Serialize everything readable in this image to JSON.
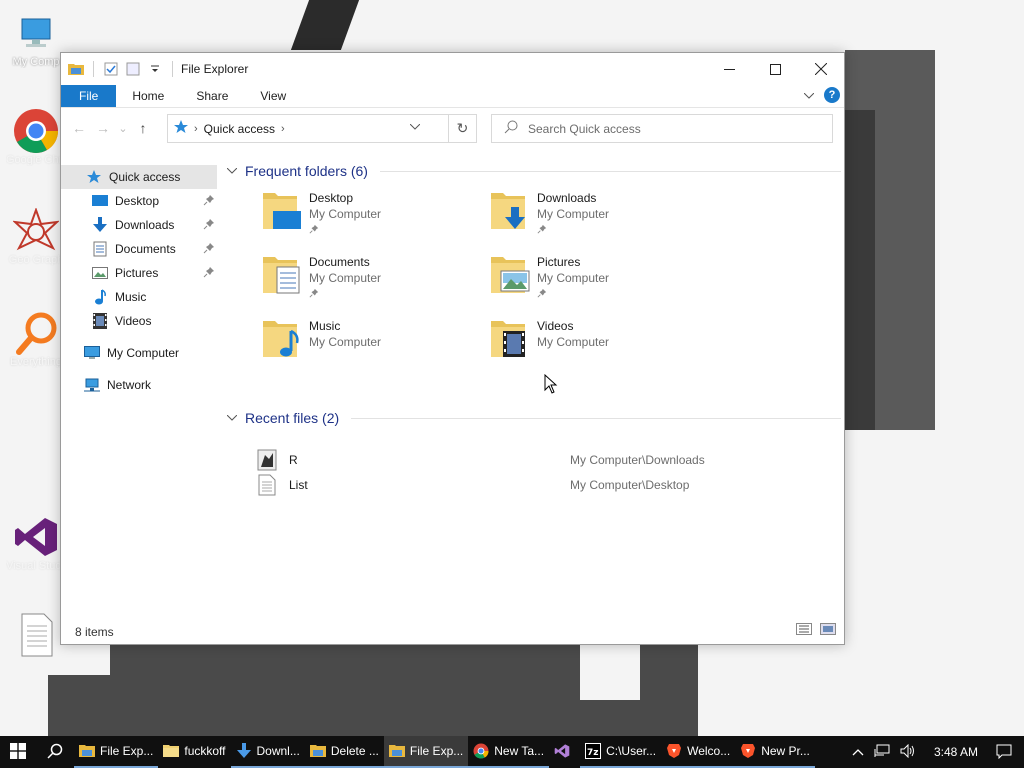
{
  "desktop": {
    "icons": [
      {
        "label": "My Comp",
        "icon": "computer-icon"
      },
      {
        "label": "Google Chrome",
        "icon": "chrome-icon"
      },
      {
        "label": "Geo Graph",
        "icon": "star-icon"
      },
      {
        "label": "Everything",
        "icon": "everything-icon"
      },
      {
        "label": "Visual Studio",
        "icon": "visual-studio-icon"
      },
      {
        "label": "",
        "icon": "document-icon"
      }
    ]
  },
  "window": {
    "title": "File Explorer",
    "controls": {
      "minimize": "—",
      "maximize": "☐",
      "close": "✕"
    }
  },
  "ribbon": {
    "tabs": [
      "File",
      "Home",
      "Share",
      "View"
    ],
    "help": "?"
  },
  "navbar": {
    "back": "←",
    "forward": "→",
    "recent": "⌄",
    "up": "↑",
    "address": "Quick access",
    "refresh": "↻",
    "search_placeholder": "Search Quick access"
  },
  "sidebar": {
    "items": [
      {
        "label": "Quick access",
        "icon": "star-icon",
        "selected": true
      },
      {
        "label": "Desktop",
        "icon": "desktop-icon",
        "pinned": true
      },
      {
        "label": "Downloads",
        "icon": "download-icon",
        "pinned": true
      },
      {
        "label": "Documents",
        "icon": "documents-icon",
        "pinned": true
      },
      {
        "label": "Pictures",
        "icon": "pictures-icon",
        "pinned": true
      },
      {
        "label": "Music",
        "icon": "music-icon"
      },
      {
        "label": "Videos",
        "icon": "videos-icon"
      },
      {
        "label": "My Computer",
        "icon": "computer-icon"
      },
      {
        "label": "Network",
        "icon": "network-icon"
      }
    ]
  },
  "frequent": {
    "header": "Frequent folders (6)",
    "folders": [
      {
        "name": "Desktop",
        "location": "My Computer",
        "pinned": true
      },
      {
        "name": "Downloads",
        "location": "My Computer",
        "pinned": true
      },
      {
        "name": "Documents",
        "location": "My Computer",
        "pinned": true
      },
      {
        "name": "Pictures",
        "location": "My Computer",
        "pinned": true
      },
      {
        "name": "Music",
        "location": "My Computer",
        "pinned": false
      },
      {
        "name": "Videos",
        "location": "My Computer",
        "pinned": false
      }
    ]
  },
  "recent": {
    "header": "Recent files (2)",
    "files": [
      {
        "name": "R",
        "path": "My Computer\\Downloads"
      },
      {
        "name": "List",
        "path": "My Computer\\Desktop"
      }
    ]
  },
  "status": {
    "items": "8 items"
  },
  "taskbar": {
    "items": [
      {
        "label": "File Exp...",
        "icon": "folder-icon",
        "state": "open"
      },
      {
        "label": "fuckkoff",
        "icon": "folder-icon",
        "state": "none"
      },
      {
        "label": "Downl...",
        "icon": "download-icon",
        "state": "open"
      },
      {
        "label": "Delete ...",
        "icon": "folder-icon",
        "state": "open"
      },
      {
        "label": "File Exp...",
        "icon": "folder-icon",
        "state": "active"
      },
      {
        "label": "New Ta...",
        "icon": "chrome-icon",
        "state": "open"
      },
      {
        "label": "",
        "icon": "visual-studio-icon",
        "state": "none"
      },
      {
        "label": "C:\\User...",
        "icon": "7zip-icon",
        "state": "open"
      },
      {
        "label": "Welco...",
        "icon": "brave-icon",
        "state": "open"
      },
      {
        "label": "New Pr...",
        "icon": "brave-icon",
        "state": "open"
      }
    ],
    "time": "3:48 AM"
  }
}
